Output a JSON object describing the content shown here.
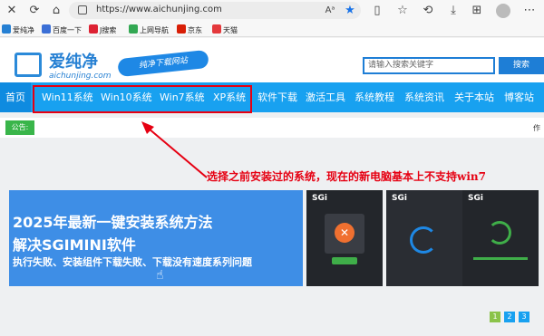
{
  "browser": {
    "url": "https://www.aichunjing.com",
    "bookmarks": [
      "爱纯净",
      "百度一下",
      "J搜索",
      "上网导航",
      "京东",
      "天猫"
    ],
    "bookmark_colors": [
      "#2680d3",
      "#3b6fd6",
      "#d23",
      "#33a853",
      "#d81e06",
      "#e4393c"
    ]
  },
  "site": {
    "logo_cn": "爱纯净",
    "logo_en": "aichunjing.com",
    "slogan": "纯净下载网站",
    "search_placeholder": "请输入搜索关键字",
    "search_button": "搜索"
  },
  "nav": {
    "home": "首页",
    "items": [
      "Win11系统",
      "Win10系统",
      "Win7系统",
      "XP系统",
      "软件下载",
      "激活工具",
      "系统教程",
      "系统资讯",
      "关于本站",
      "博客站"
    ]
  },
  "notice": {
    "tag": "公告:",
    "right": "作"
  },
  "annotation": "选择之前安装过的系统，现在的新电脑基本上不支持win7",
  "banner": {
    "line1": "2025年最新一键安装系统方法",
    "line2": "解决SGIMINI软件",
    "line3": "执行失败、安装组件下载失败、下载没有速度系列问题"
  },
  "phones": [
    {
      "title": "SGi"
    },
    {
      "title": "SGi"
    },
    {
      "title": "SGi"
    }
  ],
  "pager": [
    "1",
    "2",
    "3"
  ],
  "colors": {
    "nav": "#18a1f0",
    "accent_red": "#e60012",
    "notice_green": "#39b54a"
  }
}
